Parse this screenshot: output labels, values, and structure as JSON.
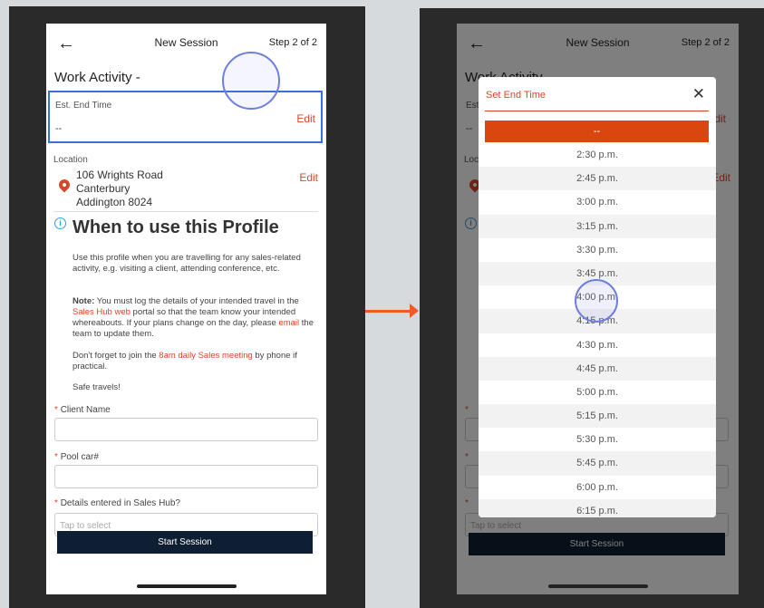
{
  "header": {
    "back_icon": "←",
    "title": "New Session",
    "step": "Step 2 of 2"
  },
  "form": {
    "section_title": "Work Activity -",
    "end_time": {
      "label": "Est. End Time",
      "value": "--",
      "edit": "Edit"
    },
    "location": {
      "label": "Location",
      "line1": "106 Wrights Road",
      "line2": "Canterbury",
      "line3": "Addington 8024",
      "edit": "Edit"
    },
    "info": {
      "icon": "i",
      "title": "When to use this Profile",
      "p1": "Use this profile when you are travelling for any sales-related activity, e.g. visiting a client, attending conference, etc.",
      "p2_bold": "Note:",
      "p2_a": " You must log the details of your intended travel in the ",
      "p2_link": "Sales Hub web",
      "p2_b": " portal so that the team know your intended whereabouts. If your plans change on the day, please ",
      "p2_link2": "email",
      "p2_c": " the team to update them.",
      "p3_a": "Don't forget to join the ",
      "p3_link": "8am daily Sales meeting",
      "p3_b": " by phone if practical.",
      "p4": "Safe travels!"
    },
    "fields": {
      "star": "*",
      "client_name": "Client Name",
      "pool_car": "Pool car#",
      "details_hub": "Details entered in Sales Hub?",
      "details_placeholder": "Tap to select"
    },
    "start_button": "Start Session"
  },
  "modal": {
    "title": "Set End Time",
    "close_icon": "✕",
    "selected": "--",
    "times": [
      "2:30 p.m.",
      "2:45 p.m.",
      "3:00 p.m.",
      "3:15 p.m.",
      "3:30 p.m.",
      "3:45 p.m.",
      "4:00 p.m.",
      "4:15 p.m.",
      "4:30 p.m.",
      "4:45 p.m.",
      "5:00 p.m.",
      "5:15 p.m.",
      "5:30 p.m.",
      "5:45 p.m.",
      "6:00 p.m.",
      "6:15 p.m."
    ]
  },
  "colors": {
    "accent": "#d9472b",
    "selected_bg": "#d9470f",
    "button_bg": "#0f1f33",
    "highlight": "#3a6fd8"
  }
}
